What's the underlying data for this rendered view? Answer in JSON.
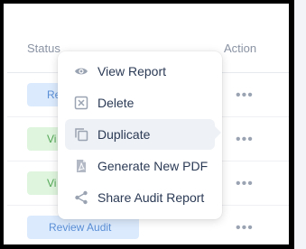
{
  "table": {
    "headers": {
      "status": "Status",
      "action": "Action"
    },
    "rows": [
      {
        "status": "Re",
        "variant": "blue",
        "action_icon": "ellipsis-icon"
      },
      {
        "status": "Vi",
        "variant": "green",
        "action_icon": "ellipsis-icon"
      },
      {
        "status": "Vi",
        "variant": "green",
        "action_icon": "ellipsis-icon"
      },
      {
        "status": "Review Audit",
        "variant": "blue",
        "action_icon": "ellipsis-icon"
      }
    ]
  },
  "context_menu": {
    "items": [
      {
        "label": "View Report",
        "icon": "eye-icon"
      },
      {
        "label": "Delete",
        "icon": "delete-box-icon"
      },
      {
        "label": "Duplicate",
        "icon": "copy-icon",
        "active": true
      },
      {
        "label": "Generate New PDF",
        "icon": "pdf-icon"
      },
      {
        "label": "Share Audit Report",
        "icon": "share-icon"
      }
    ]
  },
  "ellipsis_glyph": "•••",
  "colors": {
    "badge_blue_bg": "#dbeafd",
    "badge_green_bg": "#dff5dd",
    "menu_text": "#2b3a55",
    "icon_gray": "#9aa3b2"
  }
}
